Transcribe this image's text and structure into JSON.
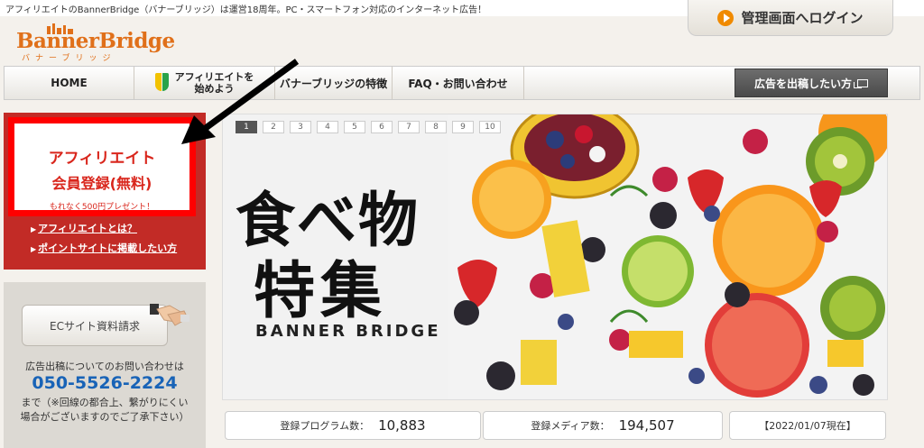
{
  "header": {
    "tagline": "アフィリエイトのBannerBridge（バナーブリッジ）は運営18周年。PC・スマートフォン対応のインターネット広告！",
    "logo_text": "BannerBridge",
    "logo_kana": "バナーブリッジ",
    "login_label": "管理画面へログイン"
  },
  "nav": {
    "home": "HOME",
    "affiliate_line1": "アフィリエイトを",
    "affiliate_line2": "始めよう",
    "about": "バナーブリッジの特徴",
    "faq": "FAQ・お問い合わせ",
    "ad_button": "広告を出稿したい方"
  },
  "sidebar": {
    "register_line1": "アフィリエイト",
    "register_line2": "会員登録(無料)",
    "register_line3": "もれなく500円プレゼント！",
    "link1": "アフィリエイトとは？",
    "link2": "ポイントサイトに掲載したい方",
    "ec_button": "ECサイト資料請求",
    "contact_line1": "広告出稿についてのお問い合わせは",
    "phone": "050-5526-2224",
    "contact_line2": "まで（※回線の都合上、繋がりにくい",
    "contact_line3": "場合がございますのでご了承下さい）"
  },
  "banner": {
    "pages": [
      "1",
      "2",
      "3",
      "4",
      "5",
      "6",
      "7",
      "8",
      "9",
      "10"
    ],
    "active_page": "1",
    "headline1": "食べ物",
    "headline2": "特集",
    "brand": "BANNER BRIDGE"
  },
  "stats": {
    "programs_label": "登録プログラム数：",
    "programs_value": "10,883",
    "media_label": "登録メディア数：",
    "media_value": "194,507",
    "date": "【2022/01/07現在】"
  },
  "colors": {
    "brand_orange": "#e0701a",
    "sidebar_red": "#c22b26",
    "highlight_red": "#ff0000",
    "phone_blue": "#1863b7"
  }
}
